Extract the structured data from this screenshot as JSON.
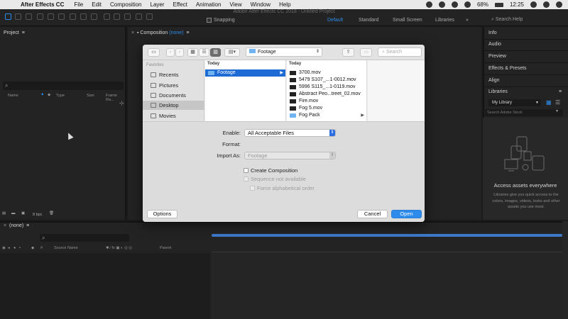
{
  "menubar": {
    "app": "After Effects CC",
    "items": [
      "File",
      "Edit",
      "Composition",
      "Layer",
      "Effect",
      "Animation",
      "View",
      "Window",
      "Help"
    ],
    "battery": "68%",
    "clock": "12:25"
  },
  "toolbar": {
    "title": "Adobe After Effects CC 2018 - Untitled Project",
    "snapping": "Snapping",
    "workspaces": [
      "Default",
      "Standard",
      "Small Screen",
      "Libraries"
    ],
    "active_workspace": "Default",
    "help_search": "Search Help",
    "overflow": "»"
  },
  "project": {
    "title": "Project",
    "columns": [
      "Name",
      "Type",
      "Size",
      "Frame Ra..."
    ],
    "bpc": "8 bpc"
  },
  "composition": {
    "title": "Composition",
    "name": "(none)"
  },
  "right_panel": {
    "items": [
      "Info",
      "Audio",
      "Preview",
      "Effects & Presets",
      "Align",
      "Libraries"
    ],
    "library_select": "My Library",
    "library_search": "Search Adobe Stock",
    "access_title": "Access assets everywhere",
    "access_text": "Libraries give you quick access to the colors, images, videos, looks and other assets you use most."
  },
  "timeline": {
    "tab": "(none)",
    "columns": [
      "#",
      "Source Name",
      "Parent"
    ]
  },
  "dialog": {
    "location": "Footage",
    "search_placeholder": "Search",
    "favorites_header": "Favorites",
    "favorites": [
      "Recents",
      "Pictures",
      "Documents",
      "Desktop",
      "Movies"
    ],
    "selected_favorite": "Desktop",
    "col1_head": "Today",
    "col1_items": [
      {
        "name": "Footage",
        "type": "folder",
        "selected": true
      }
    ],
    "col2_head": "Today",
    "col2_items": [
      {
        "name": "3700.mov",
        "type": "video"
      },
      {
        "name": "5479 S107_...1-0012.mov",
        "type": "video"
      },
      {
        "name": "5996 S115_...1-0119.mov",
        "type": "video"
      },
      {
        "name": "Abstract Peo...treet_02.mov",
        "type": "video"
      },
      {
        "name": "Fire.mov",
        "type": "video"
      },
      {
        "name": "Fog 5.mov",
        "type": "video"
      },
      {
        "name": "Fog Pack",
        "type": "folder"
      }
    ],
    "enable_label": "Enable:",
    "enable_value": "All Acceptable Files",
    "format_label": "Format:",
    "import_label": "Import As:",
    "import_value": "Footage",
    "create_comp": "Create Composition",
    "sequence": "Sequence not available",
    "force_alpha": "Force alphabetical order",
    "options_btn": "Options",
    "cancel_btn": "Cancel",
    "open_btn": "Open"
  }
}
